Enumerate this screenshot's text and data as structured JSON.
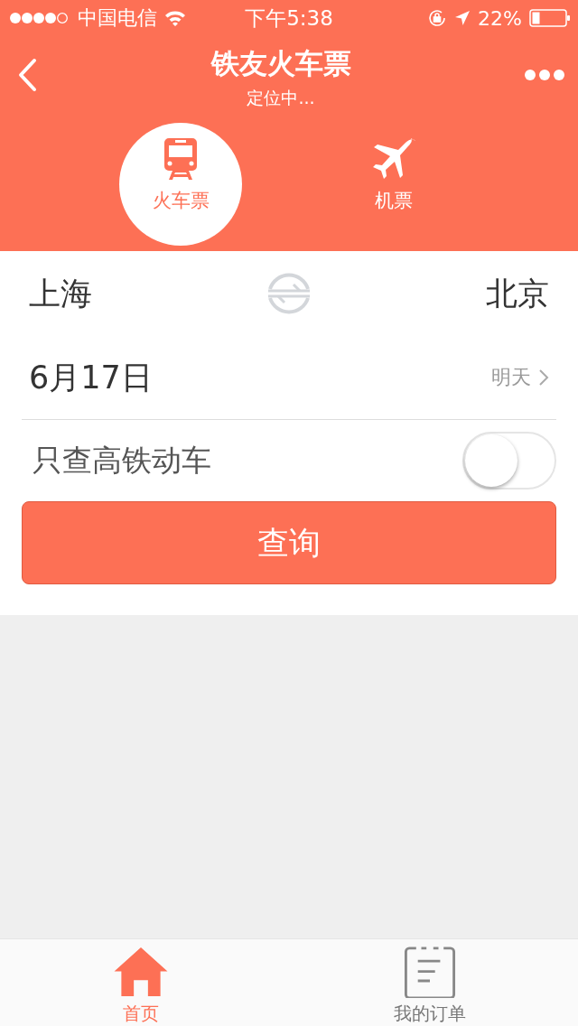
{
  "status_bar": {
    "carrier": "中国电信",
    "time": "下午5:38",
    "battery": "22%"
  },
  "nav": {
    "title": "铁友火车票",
    "subtitle": "定位中..."
  },
  "modes": [
    {
      "label": "火车票",
      "kind": "train",
      "selected": true
    },
    {
      "label": "机票",
      "kind": "plane",
      "selected": false
    }
  ],
  "form": {
    "from": "上海",
    "to": "北京",
    "date": "6月17日",
    "date_hint": "明天",
    "filter_label": "只查高铁动车",
    "filter_on": false,
    "search_button": "查询"
  },
  "tab_bar": [
    {
      "label": "首页",
      "kind": "home",
      "selected": true
    },
    {
      "label": "我的订单",
      "kind": "orders",
      "selected": false
    }
  ]
}
